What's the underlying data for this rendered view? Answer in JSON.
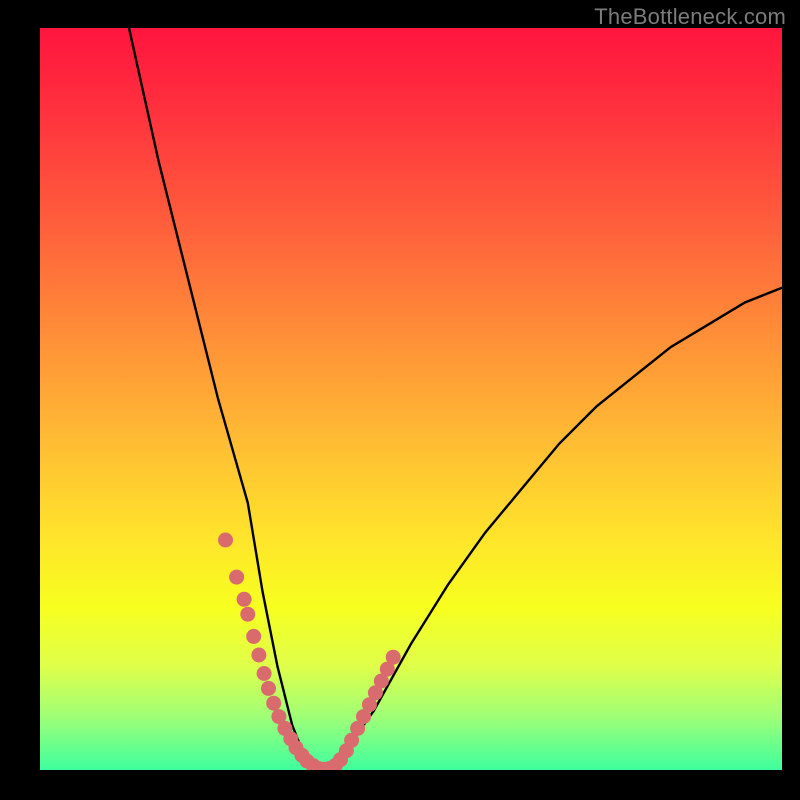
{
  "watermark": "TheBottleneck.com",
  "chart_data": {
    "type": "line",
    "title": "",
    "xlabel": "",
    "ylabel": "",
    "xlim": [
      0,
      100
    ],
    "ylim": [
      0,
      100
    ],
    "series": [
      {
        "name": "bottleneck-curve",
        "x": [
          12,
          16,
          20,
          24,
          28,
          30,
          32,
          34,
          36,
          38,
          40,
          45,
          50,
          55,
          60,
          65,
          70,
          75,
          80,
          85,
          90,
          95,
          100
        ],
        "values": [
          100,
          82,
          66,
          50,
          36,
          24,
          14,
          6,
          1,
          0,
          1,
          8,
          17,
          25,
          32,
          38,
          44,
          49,
          53,
          57,
          60,
          63,
          65
        ]
      }
    ],
    "markers": {
      "name": "highlight-dots",
      "color": "#d96b6e",
      "x": [
        25.0,
        26.5,
        27.5,
        28.0,
        28.8,
        29.5,
        30.2,
        30.8,
        31.5,
        32.2,
        33.0,
        33.8,
        34.5,
        35.3,
        36.0,
        36.8,
        37.5,
        38.2,
        39.0,
        39.8,
        40.5,
        41.3,
        42.0,
        42.8,
        43.6,
        44.4,
        45.2,
        46.0,
        46.8,
        47.6
      ],
      "values": [
        31.0,
        26.0,
        23.0,
        21.0,
        18.0,
        15.5,
        13.0,
        11.0,
        9.0,
        7.2,
        5.6,
        4.2,
        3.0,
        2.0,
        1.2,
        0.6,
        0.2,
        0.1,
        0.2,
        0.6,
        1.4,
        2.6,
        4.0,
        5.6,
        7.2,
        8.8,
        10.4,
        12.0,
        13.6,
        15.2
      ]
    },
    "gradient_stops": [
      {
        "pos": 0,
        "color": "#ff153e"
      },
      {
        "pos": 40,
        "color": "#ff8a38"
      },
      {
        "pos": 78,
        "color": "#f7ff1f"
      },
      {
        "pos": 100,
        "color": "#3eff9e"
      }
    ]
  }
}
